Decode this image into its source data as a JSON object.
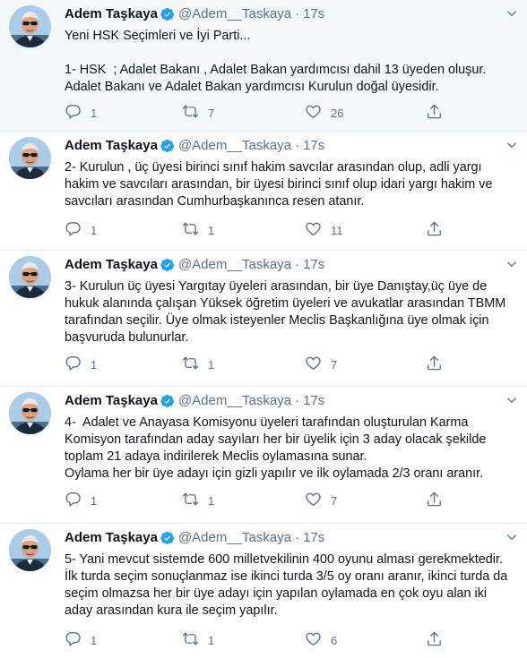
{
  "tweets": [
    {
      "name": "Adem Taşkaya",
      "handle": "@Adem__Taskaya",
      "separator": "·",
      "time": "17s",
      "text": "Yeni HSK Seçimleri ve İyi Parti...\n\n1- HSK  ; Adalet Bakanı , Adalet Bakan yardımcısı dahil 13 üyeden oluşur.\nAdalet Bakanı ve Adalet Bakan yardımcısı Kurulun doğal üyesidir.",
      "replies": "1",
      "retweets": "7",
      "likes": "26"
    },
    {
      "name": "Adem Taşkaya",
      "handle": "@Adem__Taskaya",
      "separator": "·",
      "time": "17s",
      "text": "2- Kurulun , üç üyesi birinci sınıf hakim savcılar arasından olup, adli yargı hakim ve savcıları arasından, bir üyesi birinci sınıf olup idari yargı hakim ve savcıları arasından Cumhurbaşkanınca resen atanır.",
      "replies": "1",
      "retweets": "1",
      "likes": "11"
    },
    {
      "name": "Adem Taşkaya",
      "handle": "@Adem__Taskaya",
      "separator": "·",
      "time": "17s",
      "text": "3- Kurulun üç üyesi Yargıtay üyeleri arasından, bir üye Danıştay,üç üye de hukuk alanında çalışan Yüksek öğretim üyeleri ve avukatlar arasından TBMM tarafından seçilir. Üye olmak isteyenler Meclis Başkanlığına üye olmak için başvuruda bulunurlar.",
      "replies": "1",
      "retweets": "1",
      "likes": "7"
    },
    {
      "name": "Adem Taşkaya",
      "handle": "@Adem__Taskaya",
      "separator": "·",
      "time": "17s",
      "text": "4-  Adalet ve Anayasa Komisyonu üyeleri tarafından oluşturulan Karma Komisyon tarafından aday sayıları her bir üyelik için 3 aday olacak şekilde toplam 21 adaya indirilerek Meclis oylamasına sunar.\nOylama her bir üye adayı için gizli yapılır ve ilk oylamada 2/3 oranı aranır.",
      "replies": "1",
      "retweets": "1",
      "likes": "7"
    },
    {
      "name": "Adem Taşkaya",
      "handle": "@Adem__Taskaya",
      "separator": "·",
      "time": "17s",
      "text": "5- Yani mevcut sistemde 600 milletvekilinin 400 oyunu alması gerekmektedir. İlk turda seçim sonuçlanmaz ise ikinci turda 3/5 oy oranı aranır, ikinci turda da seçim olmazsa her bir üye adayı için yapılan oylamada en çok oyu alan iki aday arasından kura ile seçim yapılır.",
      "replies": "1",
      "retweets": "1",
      "likes": "6"
    }
  ],
  "icons": {
    "verified": "verified-badge-icon",
    "reply": "reply-icon",
    "retweet": "retweet-icon",
    "like": "heart-icon",
    "share": "share-icon",
    "more": "chevron-down-icon"
  },
  "colors": {
    "text": "#0f1419",
    "secondary": "#5b7083",
    "verified": "#1da1f2",
    "highlight_bg": "#f5f8fa",
    "divider": "#e6ecf0"
  }
}
